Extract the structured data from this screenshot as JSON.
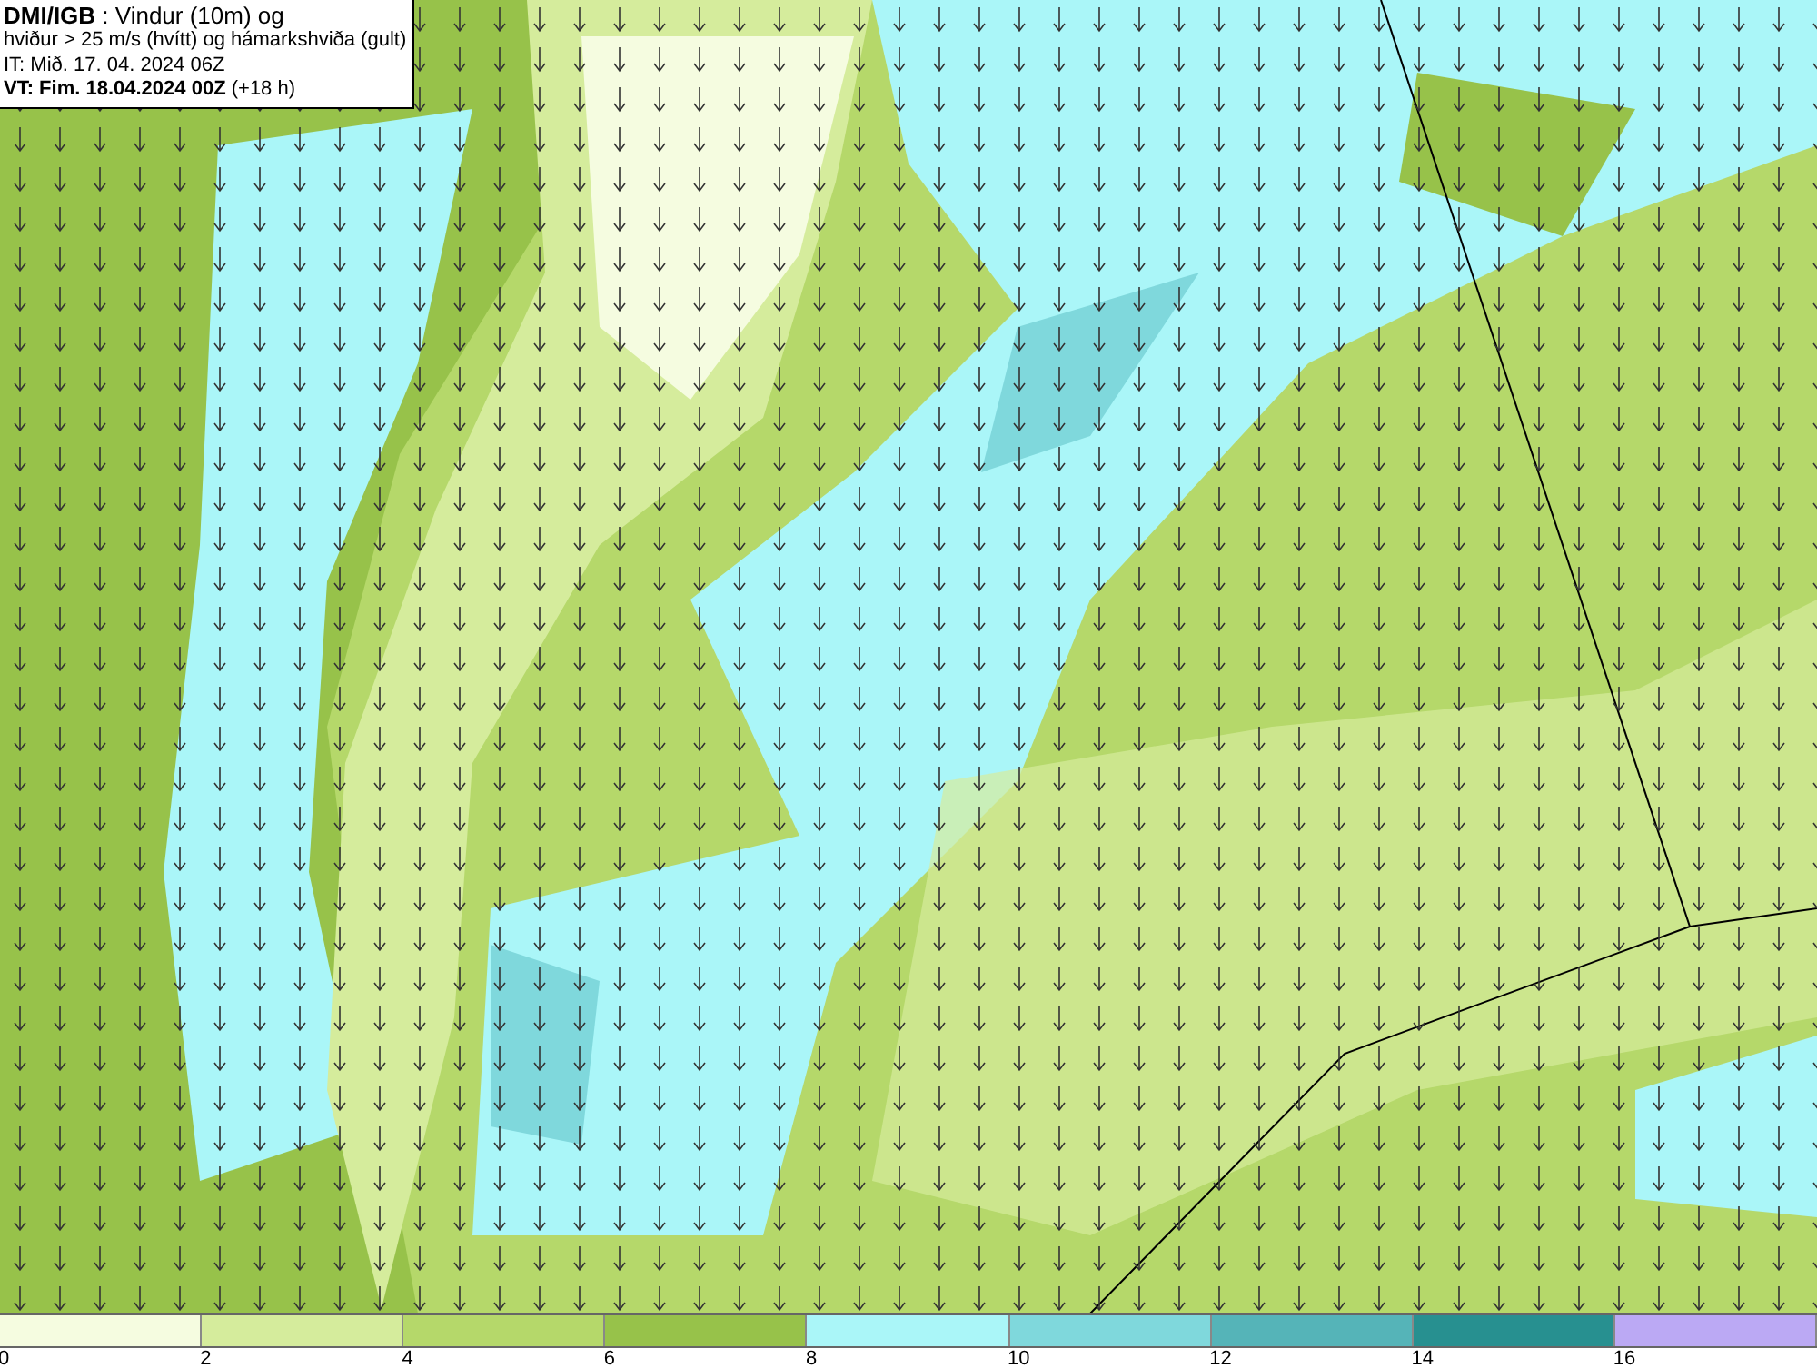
{
  "title_box": {
    "lines": [
      "**DMI/IGB** : Vindur (10m) og",
      "hviður > 25 m/s (hvítt) og hámarkshviða (gult)",
      "IT: Mið. 17. 04. 2024 06Z",
      "**VT: Fim. 18.04.2024 00Z** (+18 h)"
    ]
  },
  "legend": [
    {
      "color": "#f5fce0",
      "label": "0"
    },
    {
      "color": "#d5ec9c",
      "label": "2"
    },
    {
      "color": "#b5d86a",
      "label": "4"
    },
    {
      "color": "#97c24a",
      "label": "6"
    },
    {
      "color": "#aaf6f8",
      "label": "8"
    },
    {
      "color": "#7fd8dc",
      "label": "10"
    },
    {
      "color": "#55b4b8",
      "label": "12"
    },
    {
      "color": "#279090",
      "label": "14"
    },
    {
      "color": "#bba9f4",
      "label": "16"
    }
  ]
}
